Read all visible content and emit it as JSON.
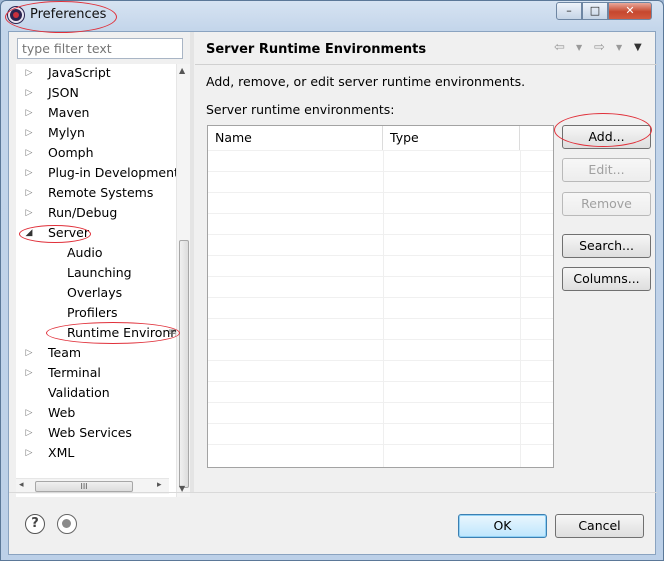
{
  "window": {
    "title": "Preferences",
    "controls": {
      "minimize": "–",
      "maximize": "□",
      "close": "✕"
    }
  },
  "filter": {
    "placeholder": "type filter text"
  },
  "tree": {
    "items": [
      {
        "label": "JavaScript",
        "arrow": "▷"
      },
      {
        "label": "JSON",
        "arrow": "▷"
      },
      {
        "label": "Maven",
        "arrow": "▷"
      },
      {
        "label": "Mylyn",
        "arrow": "▷"
      },
      {
        "label": "Oomph",
        "arrow": "▷"
      },
      {
        "label": "Plug-in Development",
        "arrow": "▷"
      },
      {
        "label": "Remote Systems",
        "arrow": "▷"
      },
      {
        "label": "Run/Debug",
        "arrow": "▷"
      },
      {
        "label": "Server",
        "arrow": "◢"
      },
      {
        "label": "Audio"
      },
      {
        "label": "Launching"
      },
      {
        "label": "Overlays"
      },
      {
        "label": "Profilers"
      },
      {
        "label": "Runtime Environm"
      },
      {
        "label": "Team",
        "arrow": "▷"
      },
      {
        "label": "Terminal",
        "arrow": "▷"
      },
      {
        "label": "Validation"
      },
      {
        "label": "Web",
        "arrow": "▷"
      },
      {
        "label": "Web Services",
        "arrow": "▷"
      },
      {
        "label": "XML",
        "arrow": "▷"
      }
    ],
    "scroll_glyphs": {
      "up": "▲",
      "down": "▼",
      "left": "◂",
      "right": "▸",
      "grip": "III"
    }
  },
  "page": {
    "title": "Server Runtime Environments",
    "nav": {
      "back": "⇦",
      "forward": "⇨",
      "menu": "▼"
    },
    "description": "Add, remove, or edit server runtime environments.",
    "table_label": "Server runtime environments:",
    "columns": [
      "Name",
      "Type"
    ]
  },
  "buttons": {
    "add": "Add...",
    "edit": "Edit...",
    "remove": "Remove",
    "search": "Search...",
    "columns": "Columns..."
  },
  "footer": {
    "help": "?",
    "ok": "OK",
    "cancel": "Cancel"
  },
  "colors": {
    "highlight_ring": "#e0303a",
    "default_button": "#3c7fb1"
  }
}
